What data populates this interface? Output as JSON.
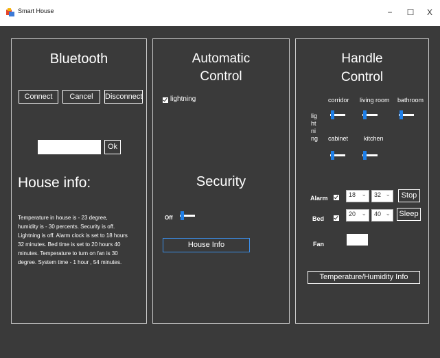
{
  "window": {
    "title": "Smart House",
    "minimize_glyph": "−",
    "maximize_glyph": "☐",
    "close_glyph": "X",
    "icon": "smart-house-app-icon"
  },
  "bluetooth": {
    "title": "Bluetooth",
    "connect_label": "Connect",
    "cancel_label": "Cancel",
    "disconnect_label": "Disconnect",
    "input_value": "",
    "ok_label": "Ok"
  },
  "house_info": {
    "title": "House info:",
    "lines": [
      "Temperature in house is - 23 degree,",
      "humidity is - 30 percents. Security is off.",
      "Lightning is off. Alarm clock is set to 18 hours",
      "32 minutes.  Bed time is set to 20 hours 40",
      "minutes.  Temperature to turn on fan is 30",
      "degree. System time - 1 hour , 54 minutes."
    ]
  },
  "automatic": {
    "title_line1": "Automatic",
    "title_line2": "Control",
    "lightning_label": "lightning",
    "lightning_checked": true
  },
  "security": {
    "title": "Security",
    "state_label": "Off",
    "house_info_button": "House Info"
  },
  "handle": {
    "title_line1": "Handle",
    "title_line2": "Control",
    "lighting_vertical": [
      "lig",
      "ht",
      "ni",
      "ng"
    ],
    "rooms": {
      "corridor": "corridor",
      "living_room": "living room",
      "bathroom": "bathroom",
      "cabinet": "cabinet",
      "kitchen": "kitchen"
    },
    "alarm_label": "Alarm",
    "alarm_checked": true,
    "alarm_hours": "18",
    "alarm_minutes": "32",
    "stop_label": "Stop",
    "bed_label": "Bed",
    "bed_checked": true,
    "bed_hours": "20",
    "bed_minutes": "40",
    "sleep_label": "Sleep",
    "fan_label": "Fan",
    "fan_value": "",
    "temp_humidity_button": "Temperature/Humidity Info"
  },
  "colors": {
    "background": "#3a3a3a",
    "accent": "#1e7fe8",
    "text": "#ffffff"
  }
}
